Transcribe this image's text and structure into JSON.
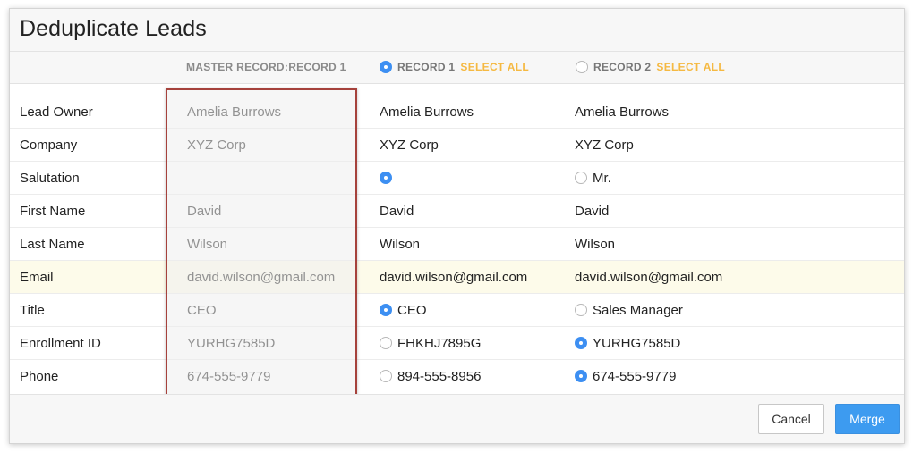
{
  "dialog": {
    "title": "Deduplicate Leads"
  },
  "header": {
    "master_label": "MASTER RECORD:RECORD 1",
    "record1": {
      "label": "RECORD 1",
      "select_all": "SELECT ALL",
      "selected": true
    },
    "record2": {
      "label": "RECORD 2",
      "select_all": "SELECT ALL",
      "selected": false
    }
  },
  "rows": [
    {
      "label": "Lead Owner",
      "master": "Amelia Burrows",
      "r1": "Amelia Burrows",
      "r2": "Amelia Burrows",
      "r1_radio": null,
      "r2_radio": null
    },
    {
      "label": "Company",
      "master": "XYZ Corp",
      "r1": "XYZ Corp",
      "r2": "XYZ Corp",
      "r1_radio": null,
      "r2_radio": null
    },
    {
      "label": "Salutation",
      "master": "",
      "r1": "",
      "r2": "Mr.",
      "r1_radio": "on",
      "r2_radio": "off"
    },
    {
      "label": "First Name",
      "master": "David",
      "r1": "David",
      "r2": "David",
      "r1_radio": null,
      "r2_radio": null
    },
    {
      "label": "Last Name",
      "master": "Wilson",
      "r1": "Wilson",
      "r2": "Wilson",
      "r1_radio": null,
      "r2_radio": null
    },
    {
      "label": "Email",
      "master": "david.wilson@gmail.com",
      "r1": "david.wilson@gmail.com",
      "r2": "david.wilson@gmail.com",
      "r1_radio": null,
      "r2_radio": null,
      "highlight": true
    },
    {
      "label": "Title",
      "master": "CEO",
      "r1": "CEO",
      "r2": "Sales Manager",
      "r1_radio": "on",
      "r2_radio": "off"
    },
    {
      "label": "Enrollment ID",
      "master": "YURHG7585D",
      "r1": "FHKHJ7895G",
      "r2": "YURHG7585D",
      "r1_radio": "off",
      "r2_radio": "on"
    },
    {
      "label": "Phone",
      "master": "674-555-9779",
      "r1": "894-555-8956",
      "r2": "674-555-9779",
      "r1_radio": "off",
      "r2_radio": "on"
    }
  ],
  "footer": {
    "cancel_label": "Cancel",
    "merge_label": "Merge"
  },
  "colors": {
    "accent": "#3d9bf0",
    "select_all": "#f5b942",
    "master_border": "#a6423c",
    "highlight_row": "#fdfbea"
  }
}
